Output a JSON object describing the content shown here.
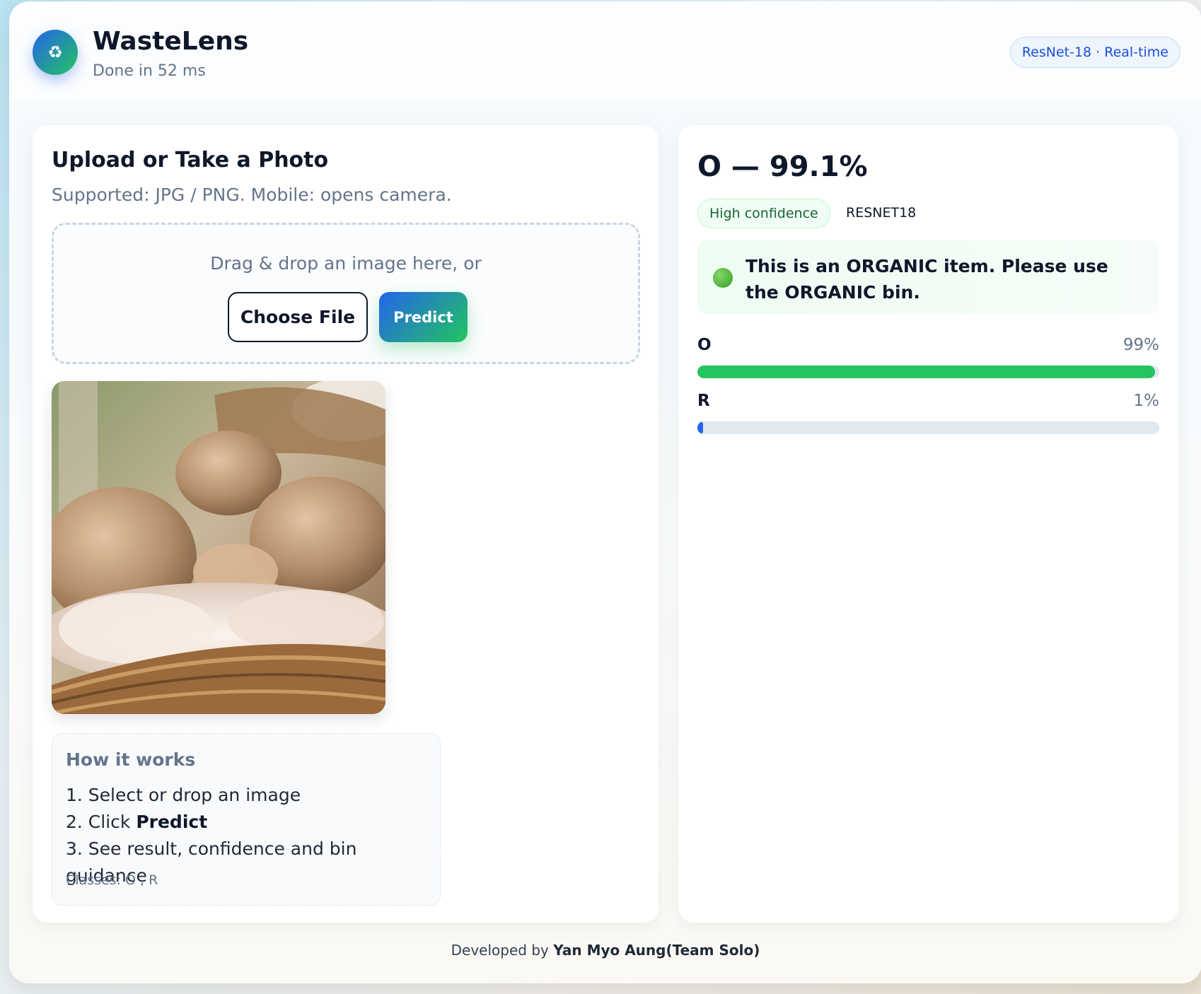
{
  "header": {
    "logo_icon": "♻",
    "title": "WasteLens",
    "status": "Done in 52 ms",
    "model_badge": "ResNet-18 · Real-time"
  },
  "upload": {
    "title": "Upload or Take a Photo",
    "subtitle": "Supported: JPG / PNG. Mobile: opens camera.",
    "drop_text": "Drag & drop an image here, or",
    "choose_label": "Choose File",
    "predict_label": "Predict"
  },
  "howto": {
    "title": "How it works",
    "step1": "1. Select or drop an image",
    "step2_prefix": "2. Click ",
    "step2_bold": "Predict",
    "step3": "3. See result, confidence and bin guidance",
    "classes": "Classes: O , R"
  },
  "result": {
    "headline": "O — 99.1%",
    "confidence_badge": "High confidence",
    "model_tag": "RESNET18",
    "guidance_icon": "green-circle-icon",
    "guidance": "This is an ORGANIC item. Please use the ORGANIC bin.",
    "probabilities": [
      {
        "label": "O",
        "value_text": "99%",
        "fraction": 0.991,
        "color": "#22c55e"
      },
      {
        "label": "R",
        "value_text": "1%",
        "fraction": 0.009,
        "color": "#2563eb"
      }
    ]
  },
  "footer": {
    "prefix": "Developed by ",
    "author": "Yan Myo Aung(Team Solo)"
  }
}
